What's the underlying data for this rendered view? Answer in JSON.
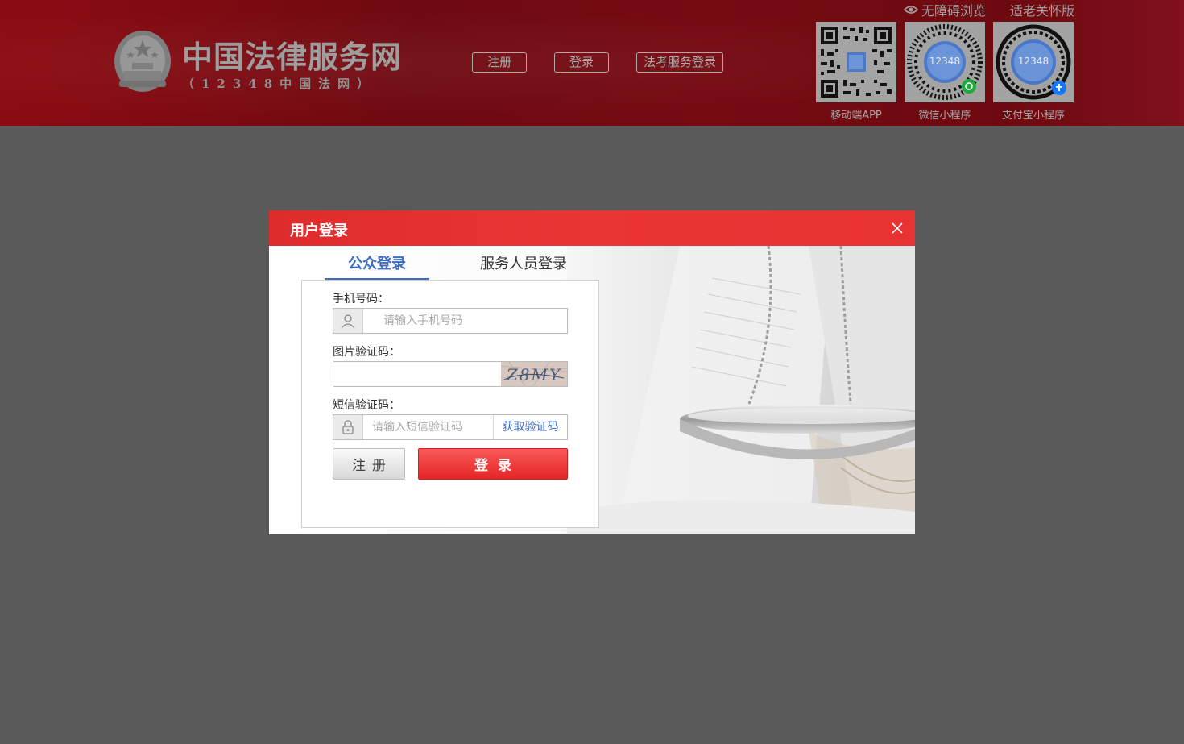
{
  "header": {
    "title": "中国法律服务网",
    "subtitle": "（12348中国法网）",
    "nav": {
      "register": "注册",
      "login": "登录",
      "exam_login": "法考服务登录"
    },
    "top_links": {
      "accessibility": "无障碍浏览",
      "elderly": "适老关怀版"
    },
    "qr": [
      {
        "label": "移动端APP"
      },
      {
        "label": "微信小程序"
      },
      {
        "label": "支付宝小程序"
      }
    ],
    "qr_badge": "12348"
  },
  "modal": {
    "title": "用户登录",
    "tabs": [
      {
        "label": "公众登录",
        "active": true
      },
      {
        "label": "服务人员登录",
        "active": false
      }
    ],
    "phone": {
      "label": "手机号码：",
      "placeholder": "请输入手机号码",
      "value": ""
    },
    "captcha": {
      "label": "图片验证码：",
      "value": "",
      "image_text": "Z8MY"
    },
    "sms": {
      "label": "短信验证码：",
      "placeholder": "请输入短信验证码",
      "button": "获取验证码"
    },
    "register_button": "注册",
    "login_button": "登录"
  },
  "colors": {
    "header_red": "#760b12",
    "modal_red": "#e73232",
    "accent_blue": "#3d6cc1",
    "overlay": "#5a5a5a"
  }
}
